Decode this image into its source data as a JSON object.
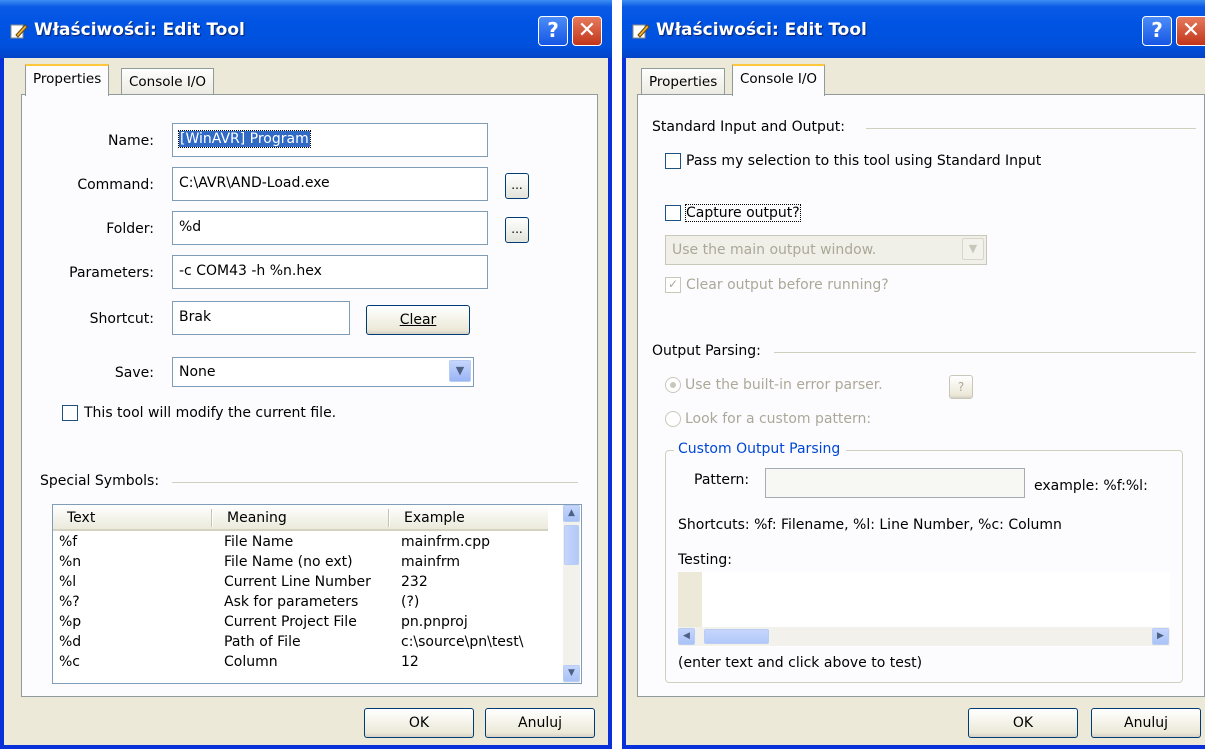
{
  "colors": {
    "titlebar": "#0054e3",
    "window_bg": "#ece9d8",
    "tab_highlight": "#ffc83c",
    "group_title": "#0046d5"
  },
  "left": {
    "title": "Właściwości: Edit Tool",
    "tabs": [
      "Properties",
      "Console I/O"
    ],
    "active_tab": "Properties",
    "name_label": "Name:",
    "name_value": "[WinAVR] Program",
    "command_label": "Command:",
    "command_value": "C:\\AVR\\AND-Load.exe",
    "folder_label": "Folder:",
    "folder_value": "%d",
    "parameters_label": "Parameters:",
    "parameters_value": "-c COM43 -h %n.hex",
    "shortcut_label": "Shortcut:",
    "shortcut_value": "Brak",
    "clear_button": "Clear",
    "save_label": "Save:",
    "save_value": "None",
    "browse_button": "...",
    "modify_checkbox": "This tool will modify the current file.",
    "special_symbols": "Special Symbols:",
    "columns": [
      "Text",
      "Meaning",
      "Example"
    ],
    "rows": [
      {
        "text": "%f",
        "meaning": "File Name",
        "example": "mainfrm.cpp"
      },
      {
        "text": "%n",
        "meaning": "File Name (no ext)",
        "example": "mainfrm"
      },
      {
        "text": "%l",
        "meaning": "Current Line Number",
        "example": "232"
      },
      {
        "text": "%?",
        "meaning": "Ask for parameters",
        "example": "(?)"
      },
      {
        "text": "%p",
        "meaning": "Current Project File",
        "example": "pn.pnproj"
      },
      {
        "text": "%d",
        "meaning": "Path of File",
        "example": "c:\\source\\pn\\test\\"
      },
      {
        "text": "%c",
        "meaning": "Column",
        "example": "12"
      }
    ],
    "ok_button": "OK",
    "cancel_button": "Anuluj"
  },
  "right": {
    "title": "Właściwości: Edit Tool",
    "tabs": [
      "Properties",
      "Console I/O"
    ],
    "active_tab": "Console I/O",
    "std_io_group": "Standard Input and Output:",
    "pass_selection": "Pass my selection to this tool using Standard Input",
    "capture_output": "Capture output?",
    "output_window_select": "Use the main output window.",
    "clear_output": "Clear output before running?",
    "output_parsing_group": "Output Parsing:",
    "builtin_parser": "Use the built-in error parser.",
    "help_button": "?",
    "custom_pattern": "Look for a custom pattern:",
    "custom_group": "Custom Output Parsing",
    "pattern_label": "Pattern:",
    "pattern_value": "",
    "example_text": "example: %f:%l:",
    "shortcuts_text": "Shortcuts: %f: Filename, %l: Line Number, %c: Column",
    "testing_label": "Testing:",
    "testing_hint": "(enter text and click above to test)",
    "ok_button": "OK",
    "cancel_button": "Anuluj"
  }
}
